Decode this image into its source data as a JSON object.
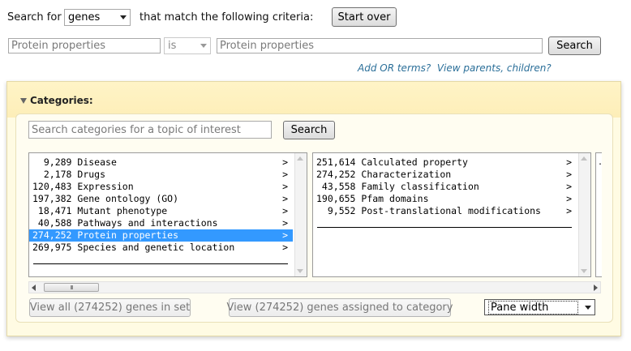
{
  "search_row": {
    "prefix": "Search for",
    "entity_value": "genes",
    "suffix": "that match the following criteria:",
    "start_over_label": "Start over"
  },
  "criteria": {
    "field_value": "Protein properties",
    "operator_value": "is",
    "term_value": "Protein properties",
    "search_label": "Search"
  },
  "links": {
    "add_or_terms": "Add OR terms?",
    "view_parents": "View parents",
    "comma": ",",
    "children": "children?"
  },
  "categories": {
    "title": "Categories:",
    "search_placeholder": "Search categories for a topic of interest",
    "search_label": "Search",
    "left_pane": [
      {
        "count": "  9,289",
        "label": "Disease",
        "arrow": ">"
      },
      {
        "count": "  2,178",
        "label": "Drugs",
        "arrow": ">"
      },
      {
        "count": "120,483",
        "label": "Expression",
        "arrow": ">"
      },
      {
        "count": "197,382",
        "label": "Gene ontology (GO)",
        "arrow": ">"
      },
      {
        "count": " 18,471",
        "label": "Mutant phenotype",
        "arrow": ">"
      },
      {
        "count": " 40,588",
        "label": "Pathways and interactions",
        "arrow": ">"
      },
      {
        "count": "274,252",
        "label": "Protein properties",
        "arrow": ">",
        "selected": true
      },
      {
        "count": "269,975",
        "label": "Species and genetic location",
        "arrow": ">"
      }
    ],
    "right_pane": [
      {
        "count": "251,614",
        "label": "Calculated property",
        "arrow": ">"
      },
      {
        "count": "274,252",
        "label": "Characterization",
        "arrow": ">"
      },
      {
        "count": " 43,558",
        "label": "Family classification",
        "arrow": ">"
      },
      {
        "count": "190,655",
        "label": "Pfam domains",
        "arrow": ">"
      },
      {
        "count": "  9,552",
        "label": "Post-translational modifications",
        "arrow": ">"
      }
    ],
    "third_pane_hint": ".",
    "scroll_thumb_glyph": "III",
    "view_all_label": "View all (274252) genes in set",
    "view_assigned_label": "View (274252) genes assigned to category",
    "pane_width_value": "Pane width"
  },
  "colors": {
    "selection": "#3399ff",
    "panel_bg": "#fffbe3",
    "link": "#2b6f99"
  }
}
